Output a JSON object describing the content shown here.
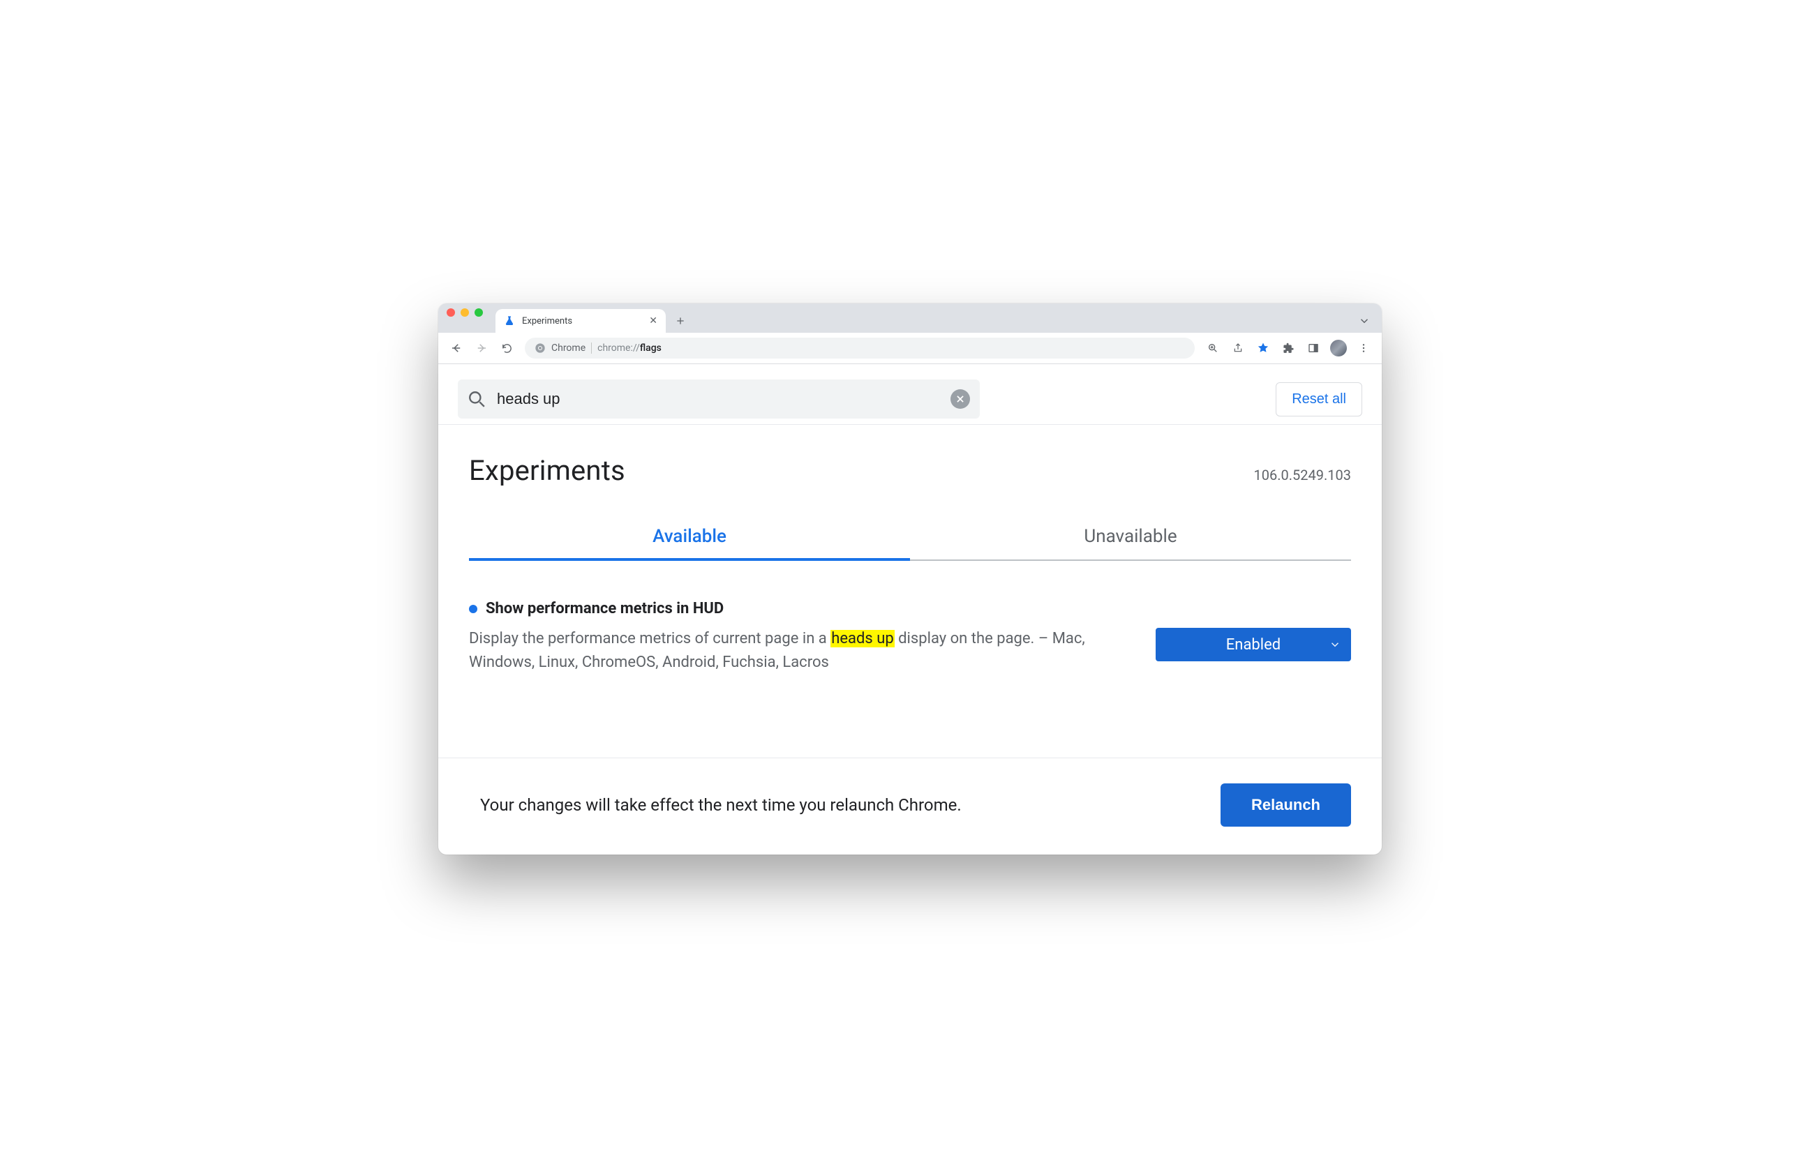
{
  "browser": {
    "tab_title": "Experiments",
    "url_chip": "Chrome",
    "url_prefix": "chrome://",
    "url_path": "flags"
  },
  "search": {
    "value": "heads up",
    "reset_label": "Reset all"
  },
  "header": {
    "title": "Experiments",
    "version": "106.0.5249.103"
  },
  "tabs": {
    "available": "Available",
    "unavailable": "Unavailable"
  },
  "flag": {
    "title": "Show performance metrics in HUD",
    "desc_pre": "Display the performance metrics of current page in a ",
    "desc_hl": "heads up",
    "desc_post": " display on the page. – Mac, Windows, Linux, ChromeOS, Android, Fuchsia, Lacros",
    "dropdown_value": "Enabled"
  },
  "footer": {
    "message": "Your changes will take effect the next time you relaunch Chrome.",
    "relaunch_label": "Relaunch"
  }
}
